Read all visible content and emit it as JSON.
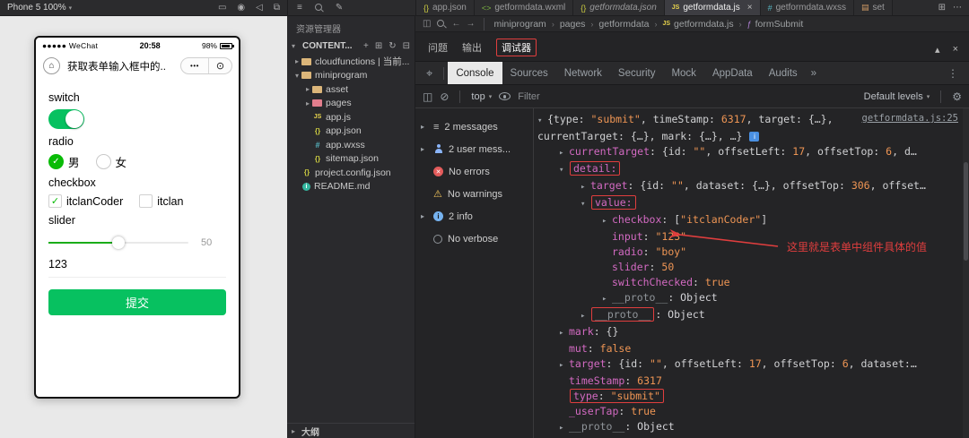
{
  "colors": {
    "wechat_green": "#07c160",
    "slider_active_green": "#1aad19",
    "annotation_red": "#e03e3e",
    "console_key": "#d36ac2",
    "console_value_orange": "#ee9554"
  },
  "toolbar": {
    "device_label": "Phone 5 100%"
  },
  "simulator": {
    "status": {
      "carrier": "●●●●● WeChat",
      "time": "20:58",
      "battery": "98%"
    },
    "nav": {
      "title": "获取表单输入框中的...",
      "menu_dots": "•••",
      "capsule_circle": "⊙"
    },
    "form": {
      "switch_label": "switch",
      "radio_label": "radio",
      "radio_options": [
        {
          "label": "男",
          "checked": true
        },
        {
          "label": "女",
          "checked": false
        }
      ],
      "checkbox_label": "checkbox",
      "checkbox_options": [
        {
          "label": "itclanCoder",
          "checked": true
        },
        {
          "label": "itclan",
          "checked": false
        }
      ],
      "slider_label": "slider",
      "slider_value": "50",
      "input_value": "123",
      "submit_label": "提交"
    }
  },
  "explorer": {
    "panel_title": "资源管理器",
    "section_label": "CONTENT...",
    "outline_label": "大纲",
    "items": [
      {
        "indent": 0,
        "arrow": "▸",
        "icon": "folder",
        "color": "#dcb67a",
        "label": "cloudfunctions | 当前..."
      },
      {
        "indent": 0,
        "arrow": "▾",
        "icon": "folder",
        "color": "#dcb67a",
        "label": "miniprogram"
      },
      {
        "indent": 1,
        "arrow": "▸",
        "icon": "folder",
        "color": "#dcb67a",
        "label": "asset"
      },
      {
        "indent": 1,
        "arrow": "▸",
        "icon": "folder",
        "color": "#e27e8d",
        "label": "pages"
      },
      {
        "indent": 1,
        "icon": "js",
        "label": "app.js"
      },
      {
        "indent": 1,
        "icon": "json",
        "label": "app.json"
      },
      {
        "indent": 1,
        "icon": "wxss",
        "label": "app.wxss"
      },
      {
        "indent": 1,
        "icon": "json",
        "label": "sitemap.json"
      },
      {
        "indent": 0,
        "icon": "json",
        "label": "project.config.json"
      },
      {
        "indent": 0,
        "icon": "md",
        "label": "README.md"
      }
    ]
  },
  "editor": {
    "tab_icons": {
      "json": "{}",
      "wxml": "<>",
      "js": "JS",
      "wxss": "#",
      "doc": "▤",
      "fn": "ƒ"
    },
    "tabs": [
      {
        "icon": "json",
        "label": "app.json"
      },
      {
        "icon": "wxml",
        "label": "getformdata.wxml"
      },
      {
        "icon": "json",
        "label": "getformdata.json",
        "italic": true
      },
      {
        "icon": "js",
        "label": "getformdata.js",
        "active": true,
        "close": "×"
      },
      {
        "icon": "wxss",
        "label": "getformdata.wxss"
      },
      {
        "icon": "doc",
        "label": "set"
      }
    ],
    "breadcrumb": [
      {
        "label": "miniprogram"
      },
      {
        "label": "pages"
      },
      {
        "label": "getformdata"
      },
      {
        "label": "getformdata.js",
        "icon": "js"
      },
      {
        "label": "formSubmit",
        "icon": "fn"
      }
    ]
  },
  "debugger": {
    "panel_tabs": [
      {
        "label": "问题"
      },
      {
        "label": "输出"
      },
      {
        "label": "调试器",
        "active": true,
        "boxed": true
      }
    ],
    "collapse_icon": "▴",
    "close_icon": "×",
    "devtools_tabs": [
      {
        "label": "Console",
        "active": true
      },
      {
        "label": "Sources"
      },
      {
        "label": "Network"
      },
      {
        "label": "Security"
      },
      {
        "label": "Mock"
      },
      {
        "label": "AppData"
      },
      {
        "label": "Audits"
      },
      {
        "label": "»",
        "overflow": true
      }
    ],
    "console": {
      "context_label": "top",
      "filter_placeholder": "Filter",
      "levels_label": "Default levels",
      "sidebar": [
        {
          "icon": "list",
          "label": "2 messages",
          "arrow": true
        },
        {
          "icon": "user",
          "label": "2 user mess...",
          "arrow": true
        },
        {
          "icon": "error",
          "label": "No errors"
        },
        {
          "icon": "warn",
          "label": "No warnings"
        },
        {
          "icon": "info",
          "label": "2 info",
          "arrow": true
        },
        {
          "icon": "verbose",
          "label": "No verbose"
        }
      ],
      "source_link": "getformdata.js:25",
      "annotation": "这里就是表单中组件具体的值",
      "tree": [
        {
          "indent": 0,
          "arrow": "open",
          "parts": [
            {
              "c": "plain",
              "t": "{type: "
            },
            {
              "c": "str",
              "t": "\"submit\""
            },
            {
              "c": "plain",
              "t": ", timeStamp: "
            },
            {
              "c": "num",
              "t": "6317"
            },
            {
              "c": "plain",
              "t": ", target: {…}, currentTarget: {…}, mark: {…}, …}"
            },
            {
              "c": "badge",
              "t": "i"
            }
          ]
        },
        {
          "indent": 1,
          "arrow": "closed",
          "parts": [
            {
              "c": "key",
              "t": "currentTarget"
            },
            {
              "c": "plain",
              "t": ": {id: "
            },
            {
              "c": "str",
              "t": "\"\""
            },
            {
              "c": "plain",
              "t": ", offsetLeft: "
            },
            {
              "c": "num",
              "t": "17"
            },
            {
              "c": "plain",
              "t": ", offsetTop: "
            },
            {
              "c": "num",
              "t": "6"
            },
            {
              "c": "plain",
              "t": ", d…"
            }
          ]
        },
        {
          "indent": 1,
          "arrow": "open",
          "box": true,
          "parts": [
            {
              "c": "key",
              "t": "detail:"
            }
          ]
        },
        {
          "indent": 2,
          "arrow": "closed",
          "parts": [
            {
              "c": "key",
              "t": "target"
            },
            {
              "c": "plain",
              "t": ": {id: "
            },
            {
              "c": "str",
              "t": "\"\""
            },
            {
              "c": "plain",
              "t": ", dataset: {…}, offsetTop: "
            },
            {
              "c": "num",
              "t": "306"
            },
            {
              "c": "plain",
              "t": ", offset…"
            }
          ]
        },
        {
          "indent": 2,
          "arrow": "open",
          "box": true,
          "parts": [
            {
              "c": "key",
              "t": "value:"
            }
          ]
        },
        {
          "indent": 3,
          "arrow": "closed",
          "parts": [
            {
              "c": "key",
              "t": "checkbox"
            },
            {
              "c": "plain",
              "t": ": ["
            },
            {
              "c": "str",
              "t": "\"itclanCoder\""
            },
            {
              "c": "plain",
              "t": "]"
            }
          ]
        },
        {
          "indent": 3,
          "parts": [
            {
              "c": "key",
              "t": "input"
            },
            {
              "c": "plain",
              "t": ": "
            },
            {
              "c": "str",
              "t": "\"123\""
            }
          ]
        },
        {
          "indent": 3,
          "parts": [
            {
              "c": "key",
              "t": "radio"
            },
            {
              "c": "plain",
              "t": ": "
            },
            {
              "c": "str",
              "t": "\"boy\""
            }
          ]
        },
        {
          "indent": 3,
          "parts": [
            {
              "c": "key",
              "t": "slider"
            },
            {
              "c": "plain",
              "t": ": "
            },
            {
              "c": "num",
              "t": "50"
            }
          ]
        },
        {
          "indent": 3,
          "parts": [
            {
              "c": "key",
              "t": "switchChecked"
            },
            {
              "c": "plain",
              "t": ": "
            },
            {
              "c": "bool",
              "t": "true"
            }
          ]
        },
        {
          "indent": 3,
          "arrow": "closed",
          "parts": [
            {
              "c": "dim",
              "t": "__proto__"
            },
            {
              "c": "plain",
              "t": ": "
            },
            {
              "c": "obj",
              "t": "Object"
            }
          ]
        },
        {
          "indent": 2,
          "arrow": "closed",
          "parts": [
            {
              "c": "dim",
              "t": "__proto__",
              "box": true
            },
            {
              "c": "plain",
              "t": ": "
            },
            {
              "c": "obj",
              "t": "Object"
            }
          ]
        },
        {
          "indent": 1,
          "arrow": "closed",
          "parts": [
            {
              "c": "key",
              "t": "mark"
            },
            {
              "c": "plain",
              "t": ": {}"
            }
          ]
        },
        {
          "indent": 1,
          "parts": [
            {
              "c": "key",
              "t": "mut"
            },
            {
              "c": "plain",
              "t": ": "
            },
            {
              "c": "bool",
              "t": "false"
            }
          ]
        },
        {
          "indent": 1,
          "arrow": "closed",
          "parts": [
            {
              "c": "key",
              "t": "target"
            },
            {
              "c": "plain",
              "t": ": {id: "
            },
            {
              "c": "str",
              "t": "\"\""
            },
            {
              "c": "plain",
              "t": ", offsetLeft: "
            },
            {
              "c": "num",
              "t": "17"
            },
            {
              "c": "plain",
              "t": ", offsetTop: "
            },
            {
              "c": "num",
              "t": "6"
            },
            {
              "c": "plain",
              "t": ", dataset:…"
            }
          ]
        },
        {
          "indent": 1,
          "parts": [
            {
              "c": "key",
              "t": "timeStamp"
            },
            {
              "c": "plain",
              "t": ": "
            },
            {
              "c": "num",
              "t": "6317"
            }
          ]
        },
        {
          "indent": 1,
          "box": true,
          "parts": [
            {
              "c": "key",
              "t": "type"
            },
            {
              "c": "plain",
              "t": ": "
            },
            {
              "c": "str",
              "t": "\"submit\""
            }
          ]
        },
        {
          "indent": 1,
          "parts": [
            {
              "c": "key",
              "t": "_userTap"
            },
            {
              "c": "plain",
              "t": ": "
            },
            {
              "c": "bool",
              "t": "true"
            }
          ]
        },
        {
          "indent": 1,
          "arrow": "closed",
          "parts": [
            {
              "c": "dim",
              "t": "__proto__"
            },
            {
              "c": "plain",
              "t": ": "
            },
            {
              "c": "obj",
              "t": "Object"
            }
          ]
        }
      ]
    }
  }
}
